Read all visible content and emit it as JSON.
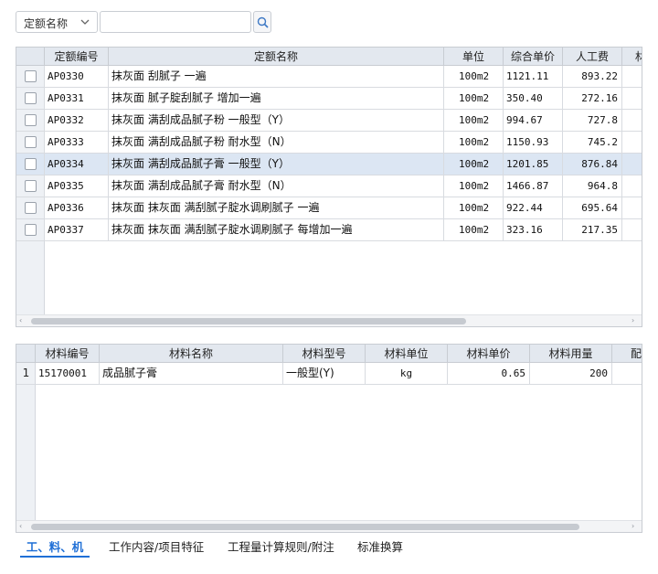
{
  "search": {
    "select_label": "定额名称",
    "input_value": "",
    "input_placeholder": ""
  },
  "quota_table": {
    "columns": [
      "定额编号",
      "定额名称",
      "单位",
      "综合单价",
      "人工费",
      "材"
    ],
    "rows": [
      {
        "code": "AP0330",
        "name": "抹灰面 刮腻子 一遍",
        "unit": "100m2",
        "price": "1121.11",
        "labor": "893.22"
      },
      {
        "code": "AP0331",
        "name": "抹灰面 腻子腚刮腻子 增加一遍",
        "unit": "100m2",
        "price": "350.40",
        "labor": "272.16"
      },
      {
        "code": "AP0332",
        "name": "抹灰面 满刮成品腻子粉 一般型（Y）",
        "unit": "100m2",
        "price": "994.67",
        "labor": "727.8"
      },
      {
        "code": "AP0333",
        "name": "抹灰面 满刮成品腻子粉 耐水型（N）",
        "unit": "100m2",
        "price": "1150.93",
        "labor": "745.2"
      },
      {
        "code": "AP0334",
        "name": "抹灰面 满刮成品腻子膏 一般型（Y）",
        "unit": "100m2",
        "price": "1201.85",
        "labor": "876.84"
      },
      {
        "code": "AP0335",
        "name": "抹灰面 满刮成品腻子膏 耐水型（N）",
        "unit": "100m2",
        "price": "1466.87",
        "labor": "964.8"
      },
      {
        "code": "AP0336",
        "name": "抹灰面 抹灰面 满刮腻子腚水调刷腻子 一遍",
        "unit": "100m2",
        "price": "922.44",
        "labor": "695.64"
      },
      {
        "code": "AP0337",
        "name": "抹灰面 抹灰面 满刮腻子腚水调刷腻子 每增加一遍",
        "unit": "100m2",
        "price": "323.16",
        "labor": "217.35"
      }
    ],
    "selected_index": 4
  },
  "material_table": {
    "columns": [
      "材料编号",
      "材料名称",
      "材料型号",
      "材料单位",
      "材料单价",
      "材料用量",
      "配"
    ],
    "rows": [
      {
        "no": "1",
        "code": "15170001",
        "name": "成品腻子膏",
        "model": "一般型(Y)",
        "unit": "kg",
        "price": "0.65",
        "qty": "200"
      }
    ]
  },
  "tabs": [
    "工、料、机",
    "工作内容/项目特征",
    "工程量计算规则/附注",
    "标准换算"
  ],
  "active_tab": 0,
  "colors": {
    "accent": "#1f6fd6",
    "header": "#e3e8ef",
    "selected_row": "#dce6f3"
  }
}
